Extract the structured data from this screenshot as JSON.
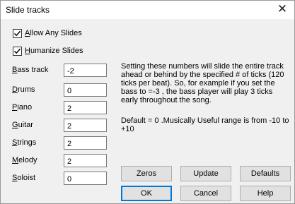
{
  "window": {
    "title": "Slide tracks",
    "close_glyph": "✕"
  },
  "options": [
    {
      "label": "Allow Any Slides",
      "underline": "A",
      "rest": "llow Any Slides",
      "checked": true
    },
    {
      "label": "Humanize Slides",
      "underline": "H",
      "rest": "umanize Slides",
      "checked": true
    }
  ],
  "tracks": [
    {
      "ul": "B",
      "rest": "ass track",
      "value": "-2"
    },
    {
      "ul": "D",
      "rest": "rums",
      "value": "0"
    },
    {
      "ul": "P",
      "rest": "iano",
      "value": "2"
    },
    {
      "ul": "G",
      "rest": "uitar",
      "value": "2"
    },
    {
      "ul": "S",
      "rest": "trings",
      "value": "2"
    },
    {
      "ul": "M",
      "rest": "elody",
      "value": "2"
    },
    {
      "ul": "S",
      "rest": "oloist",
      "value": "0"
    }
  ],
  "description": "Setting these numbers will slide the entire track ahead or behind by the specified # of ticks (120 ticks per beat). So, for example if you set the bass to =-3 , the bass player will play 3 ticks early throughout the song.",
  "default_note": "Default = 0 .Musically Useful range is from -10 to +10",
  "buttons": {
    "zeros": "Zeros",
    "update": "Update",
    "defaults": "Defaults",
    "ok": "OK",
    "cancel": "Cancel",
    "help": "Help"
  }
}
